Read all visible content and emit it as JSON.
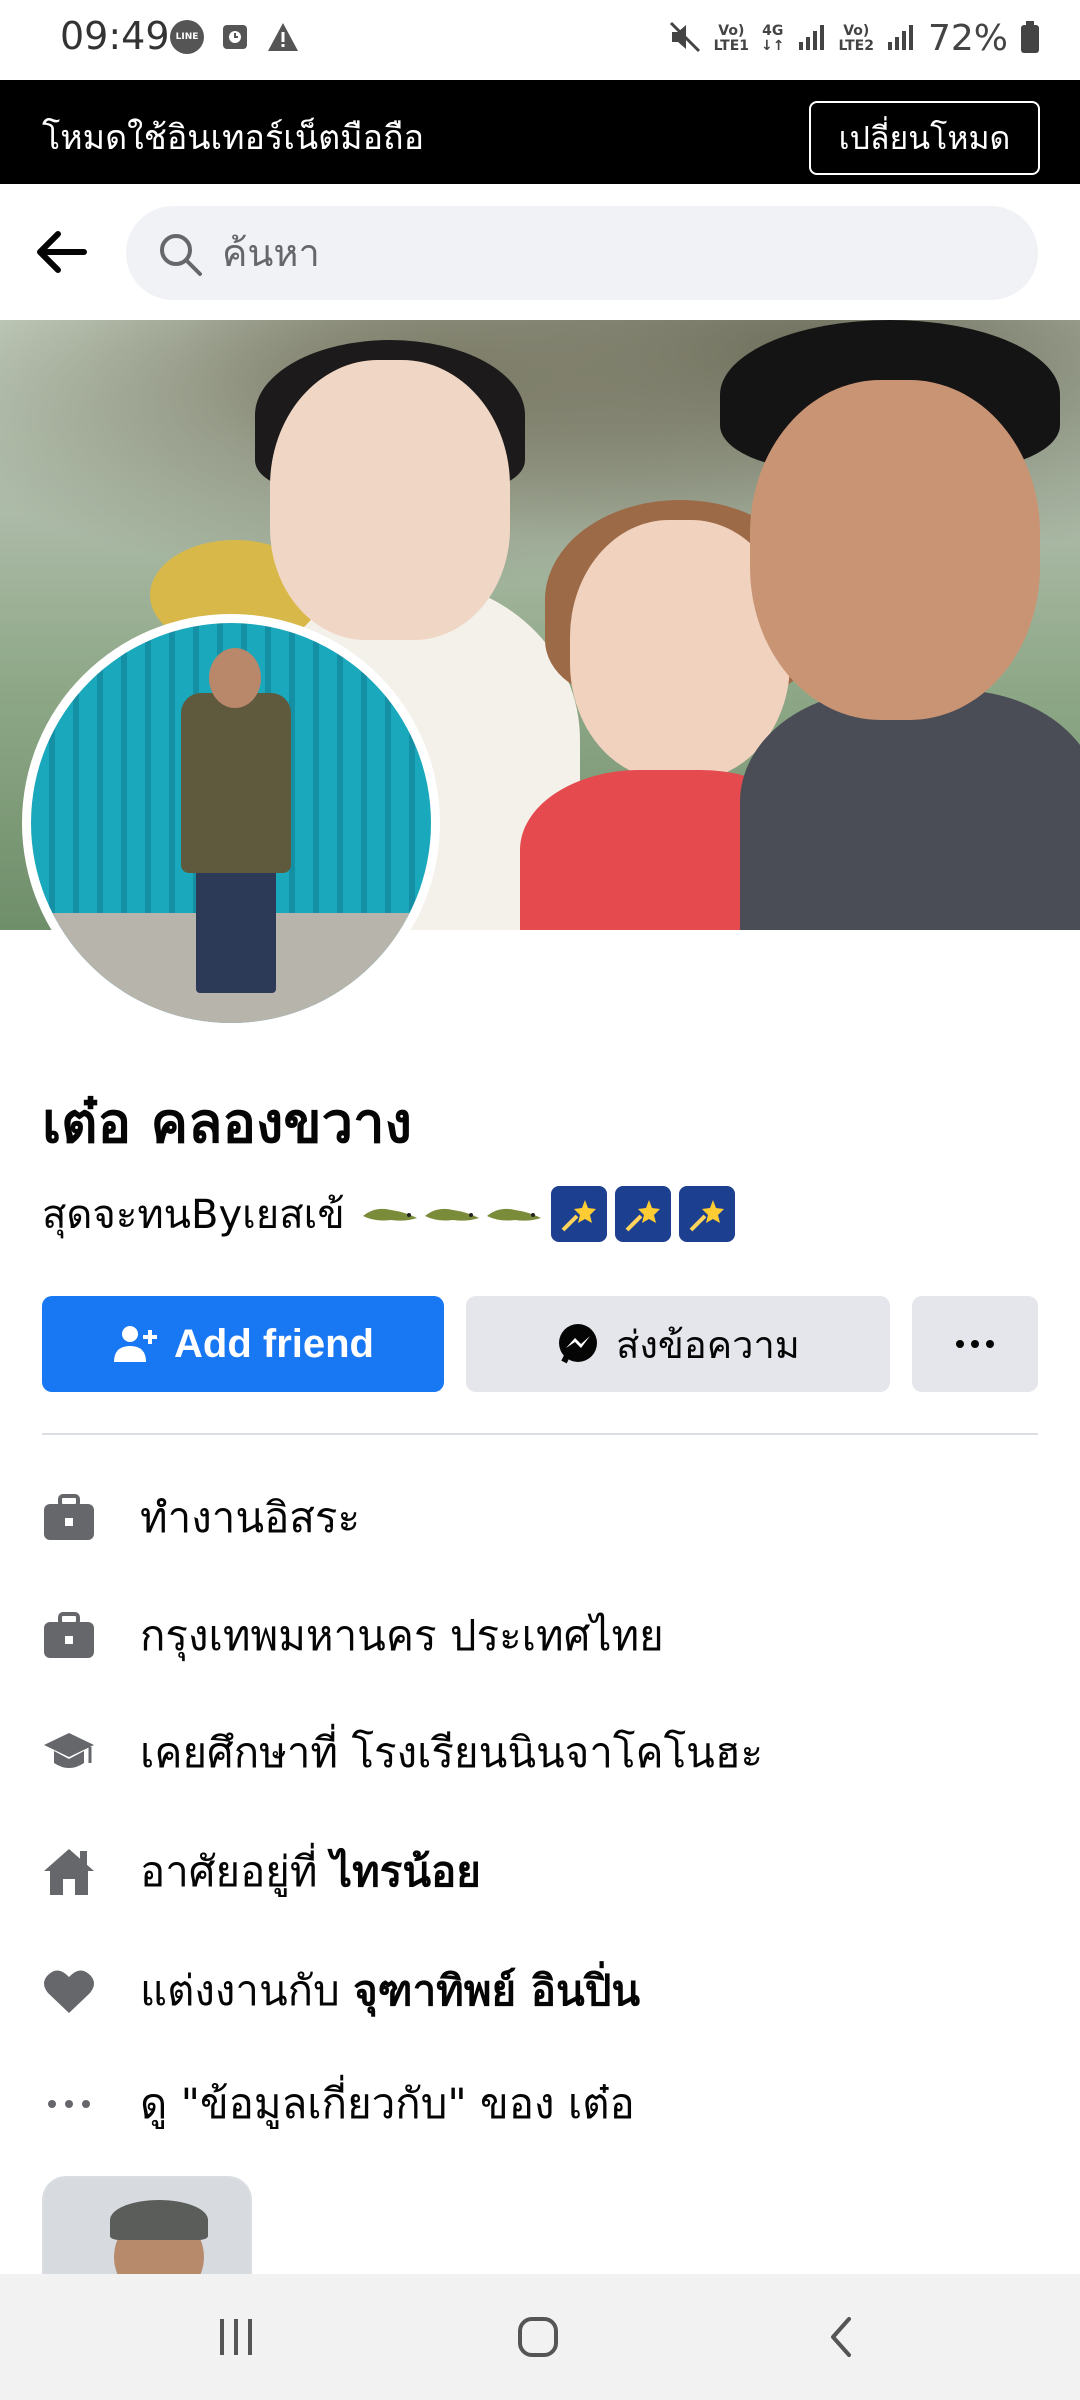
{
  "status_bar": {
    "time": "09:49",
    "line_badge": "LINE",
    "net1_top": "Vo)",
    "net1_bottom": "LTE1",
    "net_type": "4G",
    "net2_top": "Vo)",
    "net2_bottom": "LTE2",
    "battery": "72%"
  },
  "mode_banner": {
    "text": "โหมดใช้อินเทอร์เน็ตมือถือ",
    "button_label": "เปลี่ยนโหมด"
  },
  "search": {
    "placeholder": "ค้นหา"
  },
  "profile": {
    "name": "เต๋อ คลองขวาง",
    "bio": "สุดจะทนByเยสเข้"
  },
  "actions": {
    "add_friend": "Add friend",
    "message": "ส่งข้อความ"
  },
  "details": [
    {
      "icon": "briefcase-icon",
      "text": "ทำงานอิสระ",
      "bold": ""
    },
    {
      "icon": "briefcase-icon",
      "text": "กรุงเทพมหานคร ประเทศไทย",
      "bold": ""
    },
    {
      "icon": "graduation-cap-icon",
      "text": "เคยศึกษาที่ โรงเรียนนินจาโคโนฮะ",
      "bold": ""
    },
    {
      "icon": "home-icon",
      "text": "อาศัยอยู่ที่ ",
      "bold": "ไทรน้อย"
    },
    {
      "icon": "heart-icon",
      "text": "แต่งงานกับ ",
      "bold": "จุฑาทิพย์ อินปิ่น"
    },
    {
      "icon": "more-dots-icon",
      "text": "ดู \"ข้อมูลเกี่ยวกับ\" ของ เต๋อ",
      "bold": ""
    }
  ],
  "colors": {
    "primary": "#1877f2",
    "secondary_button": "#e4e6eb",
    "search_bg": "#f0f2f5",
    "icon_gray": "#65676b"
  }
}
